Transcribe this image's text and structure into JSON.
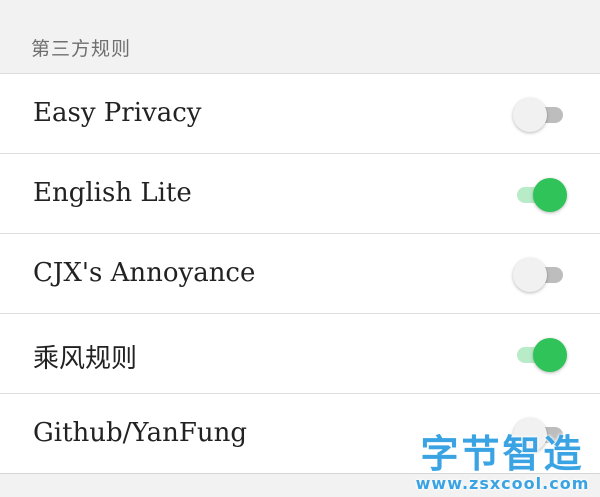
{
  "section": {
    "title": "第三方规则"
  },
  "rules": [
    {
      "label": "Easy Privacy",
      "enabled": false
    },
    {
      "label": "English Lite",
      "enabled": true
    },
    {
      "label": "CJX's Annoyance",
      "enabled": false
    },
    {
      "label": "乘风规则",
      "enabled": true
    },
    {
      "label": "Github/YanFung",
      "enabled": false
    }
  ],
  "colors": {
    "toggle_on_knob": "#2fc35a",
    "toggle_on_track": "#b8ebc8",
    "toggle_off_knob": "#f1f1f1",
    "toggle_off_track": "#bdbdbd",
    "watermark": "#3aa3e3"
  },
  "watermark": {
    "title": "字节智造",
    "url": "www.zsxcool.com"
  }
}
